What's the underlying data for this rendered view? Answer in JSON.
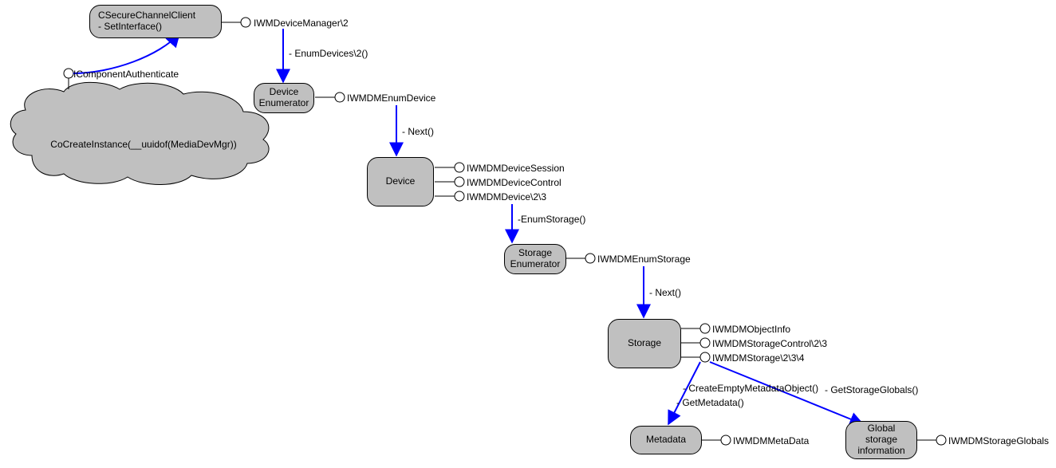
{
  "nodes": {
    "secure_client": {
      "line1": "CSecureChannelClient",
      "line2": "- SetInterface()"
    },
    "device_enum": {
      "line1": "Device",
      "line2": "Enumerator"
    },
    "device": {
      "line1": "Device"
    },
    "storage_enum": {
      "line1": "Storage",
      "line2": "Enumerator"
    },
    "storage": {
      "line1": "Storage"
    },
    "metadata": {
      "line1": "Metadata"
    },
    "global_storage": {
      "line1": "Global",
      "line2": "storage",
      "line3": "information"
    },
    "cloud": {
      "line1": "CoCreateInstance(__uuidof(MediaDevMgr))"
    }
  },
  "interfaces": {
    "icomponent_auth": "IComponentAuthenticate",
    "iwm_dev_mgr": "IWMDeviceManager\\2",
    "iwmdm_enum_dev": "IWMDMEnumDevice",
    "iwmdm_dev_sess": "IWMDMDeviceSession",
    "iwmdm_dev_ctrl": "IWMDMDeviceControl",
    "iwmdm_device": "IWMDMDevice\\2\\3",
    "iwmdm_enum_stor": "IWMDMEnumStorage",
    "iwmdm_obj_info": "IWMDMObjectInfo",
    "iwmdm_stor_ctrl": "IWMDMStorageControl\\2\\3",
    "iwmdm_storage": "IWMDMStorage\\2\\3\\4",
    "iwmdm_metadata": "IWMDMMetaData",
    "iwmdm_stor_glob": "IWMDMStorageGlobals"
  },
  "methods": {
    "enum_devices": "- EnumDevices\\2()",
    "next1": "- Next()",
    "enum_storage": "-EnumStorage()",
    "next2": "- Next()",
    "create_empty": "- CreateEmptyMetadataObject()",
    "get_metadata": "- GetMetadata()",
    "get_stor_glob": "- GetStorageGlobals()"
  }
}
